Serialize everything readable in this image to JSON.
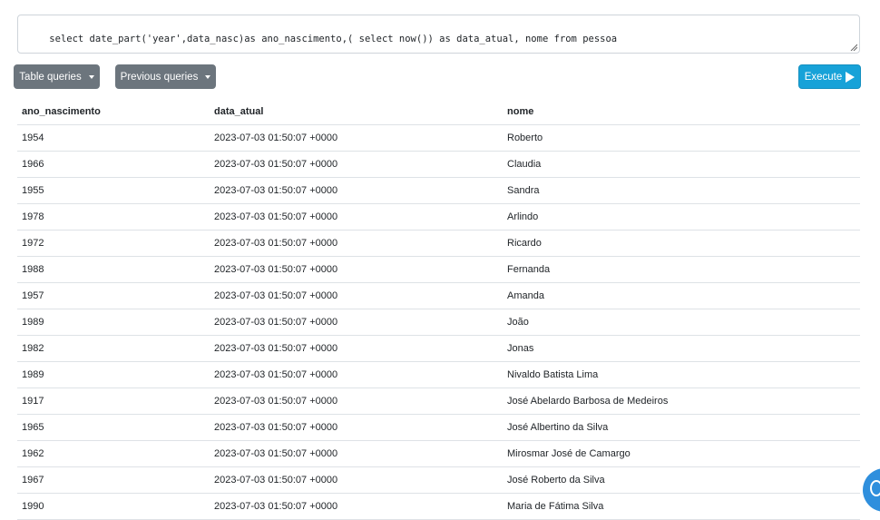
{
  "query": {
    "text": "select date_part('year',data_nasc)as ano_nascimento,( select now()) as data_atual, nome from pessoa"
  },
  "toolbar": {
    "table_queries_label": "Table queries",
    "previous_queries_label": "Previous queries",
    "execute_label": "Execute"
  },
  "results": {
    "columns": [
      "ano_nascimento",
      "data_atual",
      "nome"
    ],
    "rows": [
      [
        "1954",
        "2023-07-03 01:50:07 +0000",
        "Roberto"
      ],
      [
        "1966",
        "2023-07-03 01:50:07 +0000",
        "Claudia"
      ],
      [
        "1955",
        "2023-07-03 01:50:07 +0000",
        "Sandra"
      ],
      [
        "1978",
        "2023-07-03 01:50:07 +0000",
        "Arlindo"
      ],
      [
        "1972",
        "2023-07-03 01:50:07 +0000",
        "Ricardo"
      ],
      [
        "1988",
        "2023-07-03 01:50:07 +0000",
        "Fernanda"
      ],
      [
        "1957",
        "2023-07-03 01:50:07 +0000",
        "Amanda"
      ],
      [
        "1989",
        "2023-07-03 01:50:07 +0000",
        "João"
      ],
      [
        "1982",
        "2023-07-03 01:50:07 +0000",
        "Jonas"
      ],
      [
        "1989",
        "2023-07-03 01:50:07 +0000",
        "Nivaldo Batista Lima"
      ],
      [
        "1917",
        "2023-07-03 01:50:07 +0000",
        "José Abelardo Barbosa de Medeiros"
      ],
      [
        "1965",
        "2023-07-03 01:50:07 +0000",
        "José Albertino da Silva"
      ],
      [
        "1962",
        "2023-07-03 01:50:07 +0000",
        "Mirosmar José de Camargo"
      ],
      [
        "1967",
        "2023-07-03 01:50:07 +0000",
        "José Roberto da Silva"
      ],
      [
        "1990",
        "2023-07-03 01:50:07 +0000",
        "Maria de Fátima Silva"
      ]
    ]
  },
  "icons": {
    "dropdown": "chevron-down-icon",
    "execute": "play-icon",
    "fab": "chat-icon"
  },
  "colors": {
    "secondary_button": "#6c757d",
    "primary_button": "#17a2d8",
    "fab": "#2f8fdd"
  }
}
